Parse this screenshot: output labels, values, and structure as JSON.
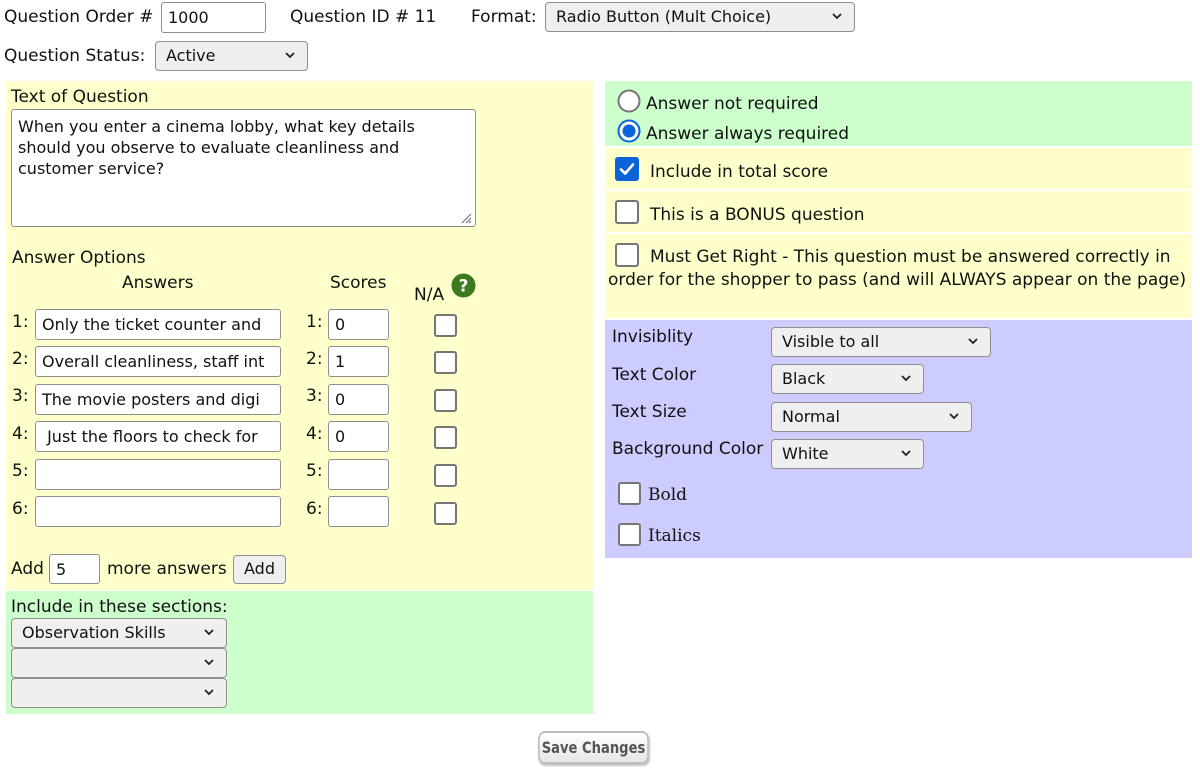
{
  "header": {
    "question_order_label": "Question Order #",
    "question_order_value": "1000",
    "question_id_label": "Question ID # 11",
    "format_label": "Format:",
    "format_value": "Radio Button (Mult Choice)",
    "status_label": "Question Status:",
    "status_value": "Active"
  },
  "question": {
    "text_label": "Text of Question",
    "text_value": "When you enter a cinema lobby, what key details should you observe to evaluate cleanliness and customer service?"
  },
  "answers": {
    "section_label": "Answer Options",
    "answers_header": "Answers",
    "scores_header": "Scores",
    "na_header": "N/A",
    "rows": [
      {
        "num": "1:",
        "answer": "Only the ticket counter and",
        "score": "0"
      },
      {
        "num": "2:",
        "answer": "Overall cleanliness, staff int",
        "score": "1"
      },
      {
        "num": "3:",
        "answer": "The movie posters and digi",
        "score": "0"
      },
      {
        "num": "4:",
        "answer": " Just the floors to check for",
        "score": "0"
      },
      {
        "num": "5:",
        "answer": "",
        "score": ""
      },
      {
        "num": "6:",
        "answer": "",
        "score": ""
      }
    ],
    "add_label": "Add",
    "add_count": "5",
    "more_answers_label": "more answers",
    "add_button": "Add"
  },
  "sections": {
    "label": "Include in these sections:",
    "selects": [
      "Observation Skills",
      "",
      ""
    ]
  },
  "requirement": {
    "not_required_label": "Answer not required",
    "always_required_label": "Answer always required",
    "selected": "always"
  },
  "options": {
    "include_total_label": "Include in total score",
    "bonus_label": "This is a BONUS question",
    "must_get_right_label": "Must Get Right - This question must be answered correctly in order for the shopper to pass (and will ALWAYS appear on the page)"
  },
  "display": {
    "invisibility_label": "Invisiblity",
    "invisibility_value": "Visible to all",
    "text_color_label": "Text Color",
    "text_color_value": "Black",
    "text_size_label": "Text Size",
    "text_size_value": "Normal",
    "bg_color_label": "Background Color",
    "bg_color_value": "White",
    "bold_label": "Bold",
    "italics_label": "Italics"
  },
  "footer": {
    "save_button": "Save Changes"
  },
  "colors": {
    "yellow_panel": "#ffffcc",
    "green_panel": "#ccffcc",
    "purple_panel": "#ccccff",
    "check_blue": "#0b63d9"
  },
  "icons": {
    "help": "question-circle-icon",
    "dropdown": "chevron-down-icon"
  }
}
